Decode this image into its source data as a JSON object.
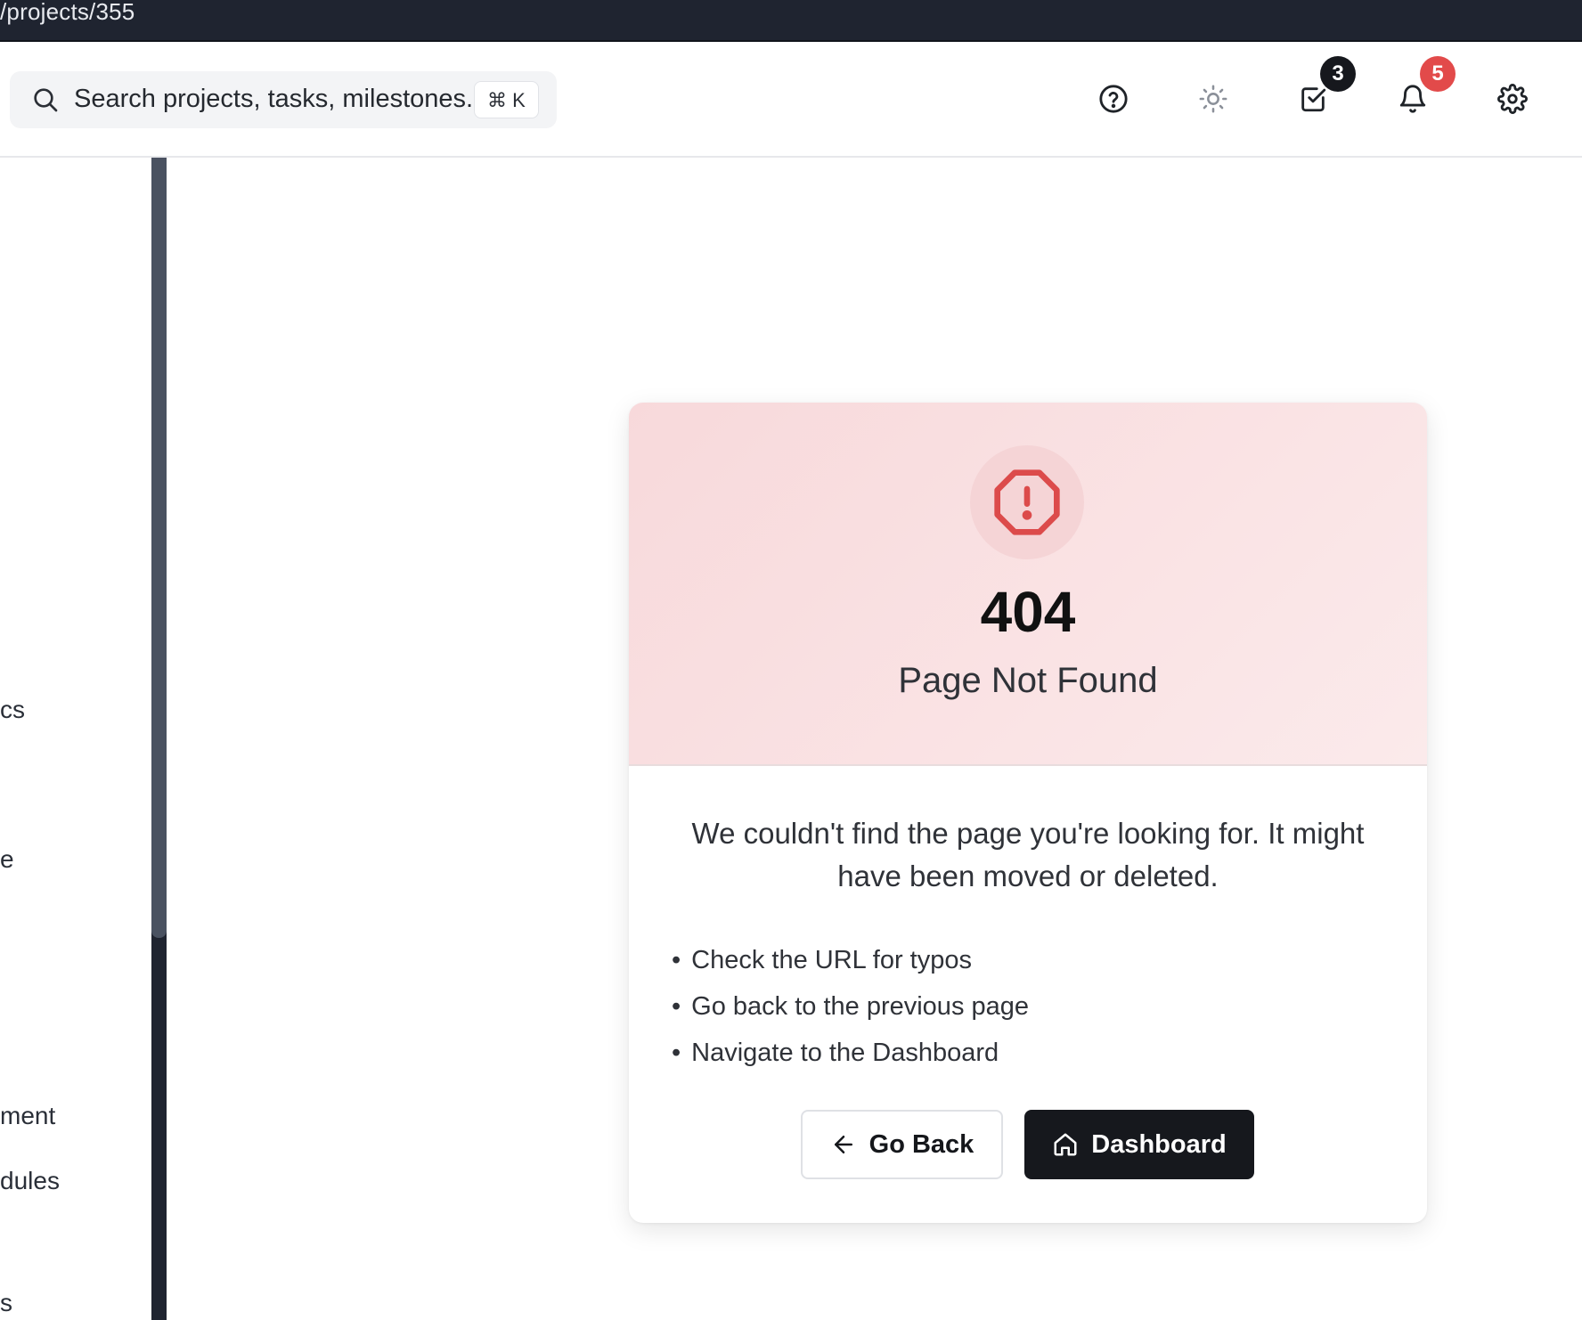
{
  "url": "/projects/355",
  "search": {
    "placeholder": "Search projects, tasks, milestones...",
    "shortcut": "⌘ K"
  },
  "header": {
    "icons": [
      "help-icon",
      "theme-sun-icon",
      "tasks-check-icon",
      "bell-icon",
      "gear-icon"
    ],
    "tasks_badge": "3",
    "notifications_badge": "5",
    "colors": {
      "tasks_badge": "#16181d",
      "notifications_badge": "#e24a4a"
    }
  },
  "sidebar": {
    "visible_fragments": [
      "cs",
      "e",
      "ment",
      "dules",
      "s"
    ]
  },
  "error": {
    "code": "404",
    "title": "Page Not Found",
    "description": "We couldn't find the page you're looking for. It might have been moved or deleted.",
    "tips": [
      "Check the URL for typos",
      "Go back to the previous page",
      "Navigate to the Dashboard"
    ],
    "back_label": "Go Back",
    "dashboard_label": "Dashboard",
    "accent": "#dc4b4b"
  }
}
